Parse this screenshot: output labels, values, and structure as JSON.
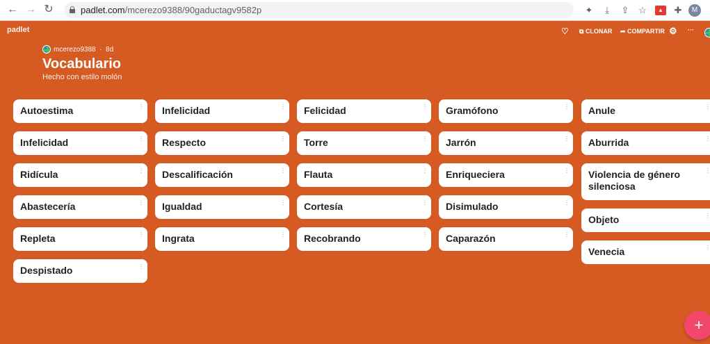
{
  "browser": {
    "url_domain": "padlet.com",
    "url_path": "/mcerezo9388/90gaductagv9582p",
    "profile_initial": "M"
  },
  "padlet": {
    "logo": "padlet",
    "toolbar": {
      "clone_label": "CLONAR",
      "share_label": "COMPARTIR",
      "more_label": "···"
    },
    "author": "mcerezo9388",
    "age": "8d",
    "title": "Vocabulario",
    "subtitle": "Hecho con estilo molón",
    "columns": [
      [
        "Autoestima",
        "Infelicidad",
        "Ridícula",
        "Abastecería",
        "Repleta",
        "Despistado"
      ],
      [
        "Infelicidad",
        "Respecto",
        "Descalificación",
        "Igualdad",
        "Ingrata"
      ],
      [
        "Felicidad",
        "Torre",
        "Flauta",
        "Cortesía",
        "Recobrando"
      ],
      [
        "Gramófono",
        "Jarrón",
        "Enriqueciera",
        "Disimulado",
        "Caparazón"
      ],
      [
        "Anule",
        "Aburrida",
        "Violencia de género silenciosa",
        "Objeto",
        "Venecia"
      ]
    ],
    "fab_label": "+"
  },
  "colors": {
    "background": "#d65b22",
    "card": "#ffffff",
    "fab": "#f2466a"
  }
}
